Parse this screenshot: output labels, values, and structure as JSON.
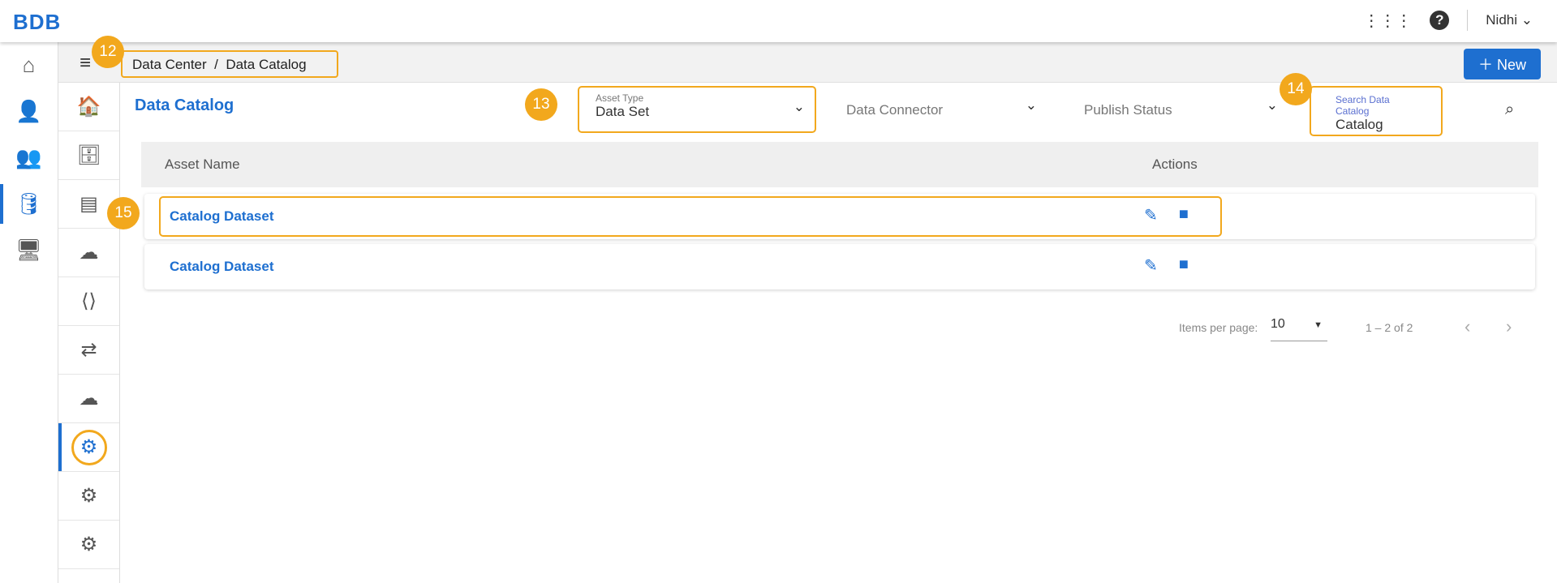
{
  "header": {
    "logo": "BDB",
    "user": "Nidhi"
  },
  "breadcrumb": {
    "items": [
      "Data Center",
      "Data Catalog"
    ],
    "separator": "/"
  },
  "new_button": "New",
  "page_title": "Data Catalog",
  "filters": {
    "asset_type": {
      "label": "Asset Type",
      "value": "Data Set"
    },
    "data_connector": {
      "placeholder": "Data Connector"
    },
    "publish_status": {
      "placeholder": "Publish Status"
    },
    "search": {
      "label": "Search Data Catalog",
      "value": "Catalog"
    }
  },
  "table": {
    "columns": [
      "Asset Name",
      "Actions"
    ],
    "rows": [
      {
        "name": "Catalog Dataset"
      },
      {
        "name": "Catalog Dataset"
      }
    ]
  },
  "pagination": {
    "items_per_page_label": "Items per page:",
    "items_per_page": "10",
    "range": "1 – 2 of 2"
  },
  "callouts": [
    "12",
    "13",
    "14",
    "15"
  ]
}
